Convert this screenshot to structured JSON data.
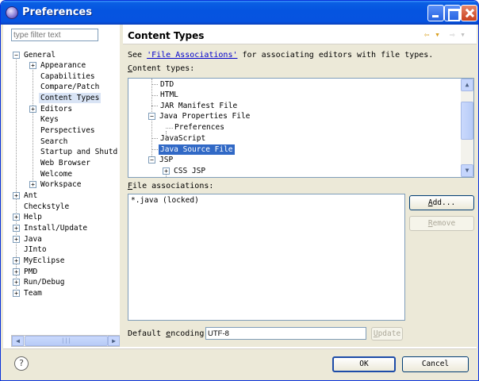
{
  "window": {
    "title": "Preferences"
  },
  "sidebar": {
    "filter_placeholder": "type filter text",
    "items": [
      {
        "label": "General",
        "expander": "−"
      },
      {
        "label": "Appearance",
        "expander": "+"
      },
      {
        "label": "Capabilities"
      },
      {
        "label": "Compare/Patch"
      },
      {
        "label": "Content Types"
      },
      {
        "label": "Editors",
        "expander": "+"
      },
      {
        "label": "Keys"
      },
      {
        "label": "Perspectives"
      },
      {
        "label": "Search"
      },
      {
        "label": "Startup and Shutd"
      },
      {
        "label": "Web Browser"
      },
      {
        "label": "Welcome"
      },
      {
        "label": "Workspace",
        "expander": "+"
      },
      {
        "label": "Ant",
        "expander": "+"
      },
      {
        "label": "Checkstyle"
      },
      {
        "label": "Help",
        "expander": "+"
      },
      {
        "label": "Install/Update",
        "expander": "+"
      },
      {
        "label": "Java",
        "expander": "+"
      },
      {
        "label": "JInto"
      },
      {
        "label": "MyEclipse",
        "expander": "+"
      },
      {
        "label": "PMD",
        "expander": "+"
      },
      {
        "label": "Run/Debug",
        "expander": "+"
      },
      {
        "label": "Team",
        "expander": "+"
      }
    ],
    "scroll_grip": "|||"
  },
  "main": {
    "title": "Content Types",
    "nav_back": "⇦ ▾",
    "nav_forward": "⇨ ▾",
    "desc_prefix": "See ",
    "desc_link": "'File Associations'",
    "desc_suffix": " for associating editors with file types.",
    "content_types_label_u": "C",
    "content_types_label_rest": "ontent types:",
    "content_types": [
      {
        "label": "DTD"
      },
      {
        "label": "HTML"
      },
      {
        "label": "JAR Manifest File"
      },
      {
        "label": "Java Properties File",
        "expander": "−"
      },
      {
        "label": "Preferences"
      },
      {
        "label": "JavaScript"
      },
      {
        "label": "Java Source File"
      },
      {
        "label": "JSP",
        "expander": "−"
      },
      {
        "label": "CSS JSP",
        "expander": "+"
      }
    ],
    "file_assoc_label_u": "F",
    "file_assoc_label_rest": "ile associations:",
    "file_associations": [
      "*.java (locked)"
    ],
    "add_u": "A",
    "add_rest": "dd...",
    "remove_u": "R",
    "remove_rest": "emove",
    "encoding_label_pre": "Default ",
    "encoding_label_u": "e",
    "encoding_label_post": "ncoding:",
    "encoding_value": "UTF-8",
    "update_u": "U",
    "update_rest": "pdate"
  },
  "footer": {
    "help": "?",
    "ok": "OK",
    "cancel": "Cancel"
  }
}
